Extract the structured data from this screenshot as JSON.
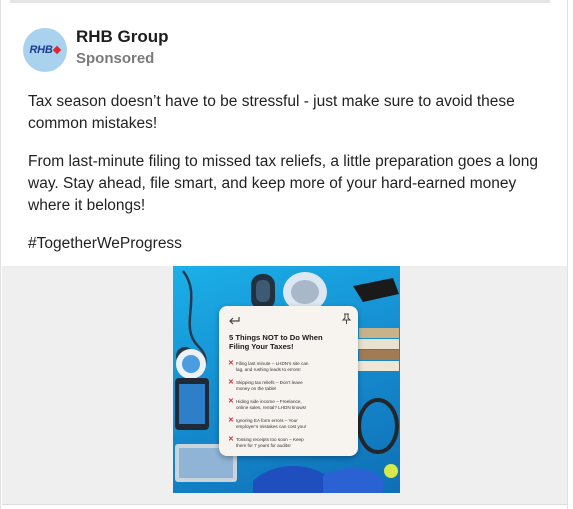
{
  "post": {
    "author": "RHB Group",
    "avatar_text": "RHB",
    "sponsored_label": "Sponsored",
    "text": {
      "line1": "Tax season doesn’t have to be stressful - just make sure to avoid these",
      "line2": "common mistakes!",
      "line3": "From last-minute filing to missed tax reliefs, a little preparation goes a long",
      "line4": "way. Stay ahead, file smart, and keep more of your hard-earned money",
      "line5": "where it belongs!",
      "hashtag": "#TogetherWeProgress"
    }
  },
  "media": {
    "note": {
      "title_line1": "5 Things NOT to Do When",
      "title_line2": "Filing Your Taxes!",
      "items": [
        {
          "line1": "Filing last minute – LHDN’s site can",
          "line2": "lag, and rushing leads to errors!"
        },
        {
          "line1": "Skipping tax reliefs – Don’t leave",
          "line2": "money on the table!"
        },
        {
          "line1": "Hiding side income – Freelance,",
          "line2": "online sales, rental? LHDN knows!"
        },
        {
          "line1": "Ignoring EA form errors – Your",
          "line2": "employer’s mistakes can cost you!"
        },
        {
          "line1": "Tossing receipts too soon – Keep",
          "line2": "them for 7 years for audits!"
        }
      ]
    }
  },
  "colors": {
    "brand_blue": "#1b3d8f",
    "brand_red": "#e3262d",
    "image_blue": "#168fd2"
  }
}
